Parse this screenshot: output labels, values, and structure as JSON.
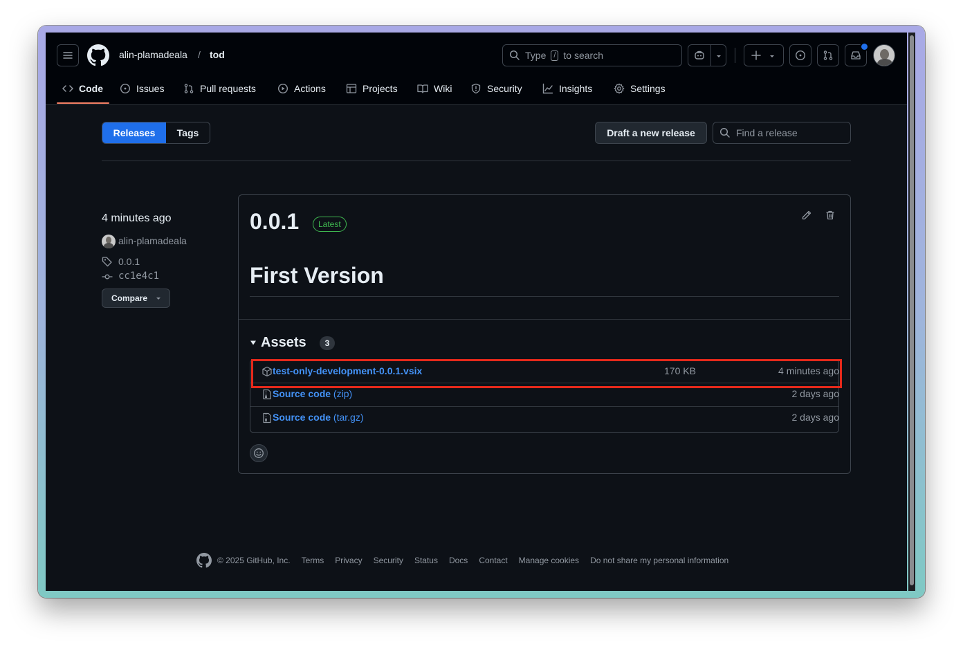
{
  "repo": {
    "owner": "alin-plamadeala",
    "separator": "/",
    "name": "tod"
  },
  "search": {
    "prefix": "Type",
    "key": "/",
    "suffix": "to search"
  },
  "nav_tabs": [
    {
      "label": "Code",
      "icon": "code-icon",
      "active": true
    },
    {
      "label": "Issues",
      "icon": "issue-icon"
    },
    {
      "label": "Pull requests",
      "icon": "pull-request-icon"
    },
    {
      "label": "Actions",
      "icon": "play-icon"
    },
    {
      "label": "Projects",
      "icon": "table-icon"
    },
    {
      "label": "Wiki",
      "icon": "book-icon"
    },
    {
      "label": "Security",
      "icon": "shield-icon"
    },
    {
      "label": "Insights",
      "icon": "graph-icon"
    },
    {
      "label": "Settings",
      "icon": "gear-icon"
    }
  ],
  "subnav": {
    "releases": "Releases",
    "tags": "Tags"
  },
  "toolbar": {
    "draft_label": "Draft a new release",
    "find_placeholder": "Find a release"
  },
  "release": {
    "time": "4 minutes ago",
    "author": "alin-plamadeala",
    "tag": "0.0.1",
    "commit": "cc1e4c1",
    "compare_label": "Compare",
    "version": "0.0.1",
    "latest_badge": "Latest",
    "title": "First Version"
  },
  "assets": {
    "heading": "Assets",
    "count": "3",
    "items": [
      {
        "name": "test-only-development-0.0.1.vsix",
        "suffix": "",
        "size": "170 KB",
        "time": "4 minutes ago",
        "highlighted": true
      },
      {
        "name": "Source code",
        "suffix": "(zip)",
        "size": "",
        "time": "2 days ago"
      },
      {
        "name": "Source code",
        "suffix": "(tar.gz)",
        "size": "",
        "time": "2 days ago"
      }
    ]
  },
  "footer": {
    "copyright": "© 2025 GitHub, Inc.",
    "links": [
      "Terms",
      "Privacy",
      "Security",
      "Status",
      "Docs",
      "Contact",
      "Manage cookies",
      "Do not share my personal information"
    ]
  },
  "colors": {
    "accent": "#1f6feb",
    "link": "#4493f8",
    "latest": "#3fb950",
    "highlight": "#e5291b",
    "background": "#0d1117"
  }
}
